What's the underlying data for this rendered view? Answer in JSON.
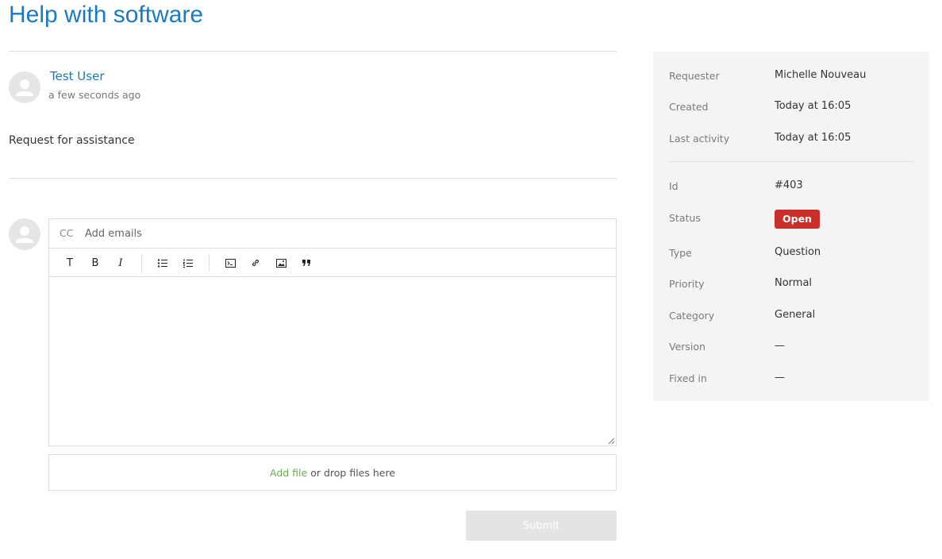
{
  "page": {
    "title": "Help with software"
  },
  "comment": {
    "author": "Test User",
    "time": "a few seconds ago",
    "body": "Request for assistance"
  },
  "reply": {
    "cc_label": "CC",
    "cc_placeholder": "Add emails",
    "toolbar": [
      {
        "name": "text-style",
        "label": "T"
      },
      {
        "name": "bold",
        "label": "B"
      },
      {
        "name": "italic",
        "label": "I"
      },
      {
        "name": "bulleted-list",
        "icon": "bulleted-list-icon"
      },
      {
        "name": "numbered-list",
        "icon": "numbered-list-icon"
      },
      {
        "name": "code",
        "icon": "code-icon"
      },
      {
        "name": "link",
        "icon": "link-icon"
      },
      {
        "name": "image",
        "icon": "image-icon"
      },
      {
        "name": "quote",
        "icon": "quote-icon"
      }
    ],
    "attach": {
      "link": "Add file",
      "rest": "or drop files here"
    },
    "submit_label": "Submit"
  },
  "properties": {
    "requester": {
      "label": "Requester",
      "value": "Michelle Nouveau"
    },
    "created": {
      "label": "Created",
      "value": "Today at 16:05"
    },
    "last_activity": {
      "label": "Last activity",
      "value": "Today at 16:05"
    },
    "id": {
      "label": "Id",
      "value": "#403"
    },
    "status": {
      "label": "Status",
      "value": "Open",
      "color": "#c9302c"
    },
    "type": {
      "label": "Type",
      "value": "Question"
    },
    "priority": {
      "label": "Priority",
      "value": "Normal"
    },
    "category": {
      "label": "Category",
      "value": "General"
    },
    "version": {
      "label": "Version",
      "value": "—"
    },
    "fixed_in": {
      "label": "Fixed in",
      "value": "—"
    }
  },
  "colors": {
    "link": "#1a7bbf",
    "accent_green": "#6ab04c",
    "status_open": "#c9302c"
  }
}
